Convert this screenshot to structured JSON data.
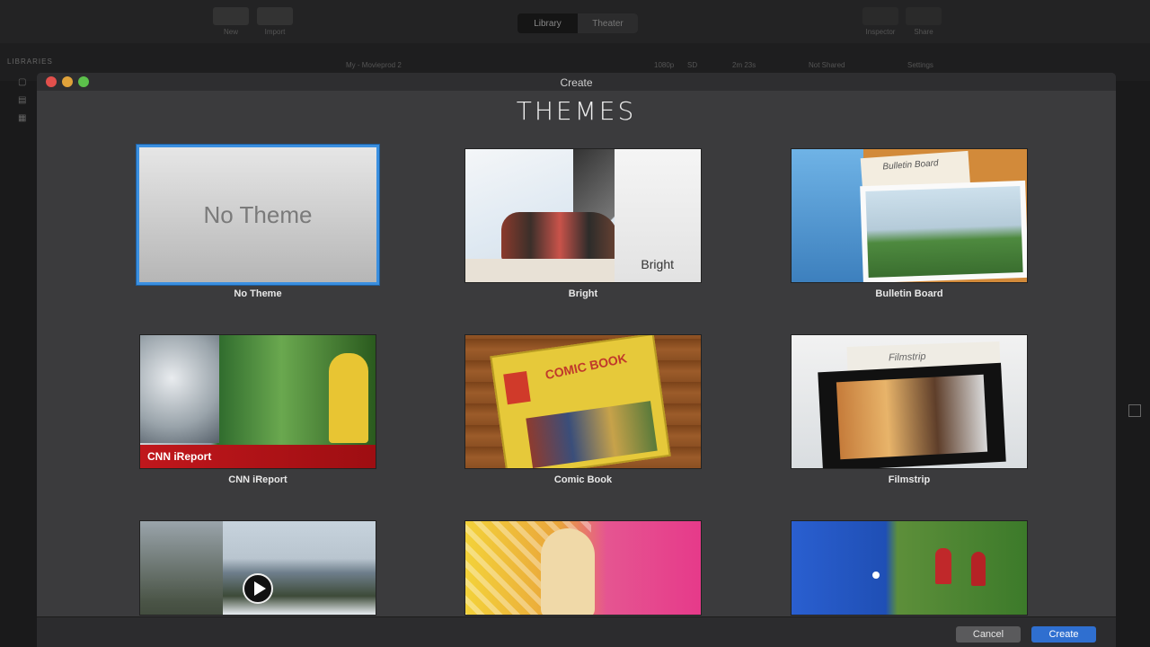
{
  "background_app": {
    "toolbar": {
      "new_label": "New",
      "import_label": "Import",
      "seg": [
        "Library",
        "Theater"
      ],
      "right_labels": [
        "Inspector",
        "Share"
      ]
    },
    "libraries_label": "LIBRARIES",
    "subbar": {
      "project": "My - Movieprod 2",
      "hd": "1080p",
      "sd": "SD",
      "duration": "2m 23s",
      "all_shared": "Not Shared",
      "settings": "Settings"
    }
  },
  "dialog": {
    "window_title": "Create",
    "heading": "THEMES",
    "themes": [
      {
        "name": "No Theme",
        "thumb_text": "No Theme",
        "selected": true
      },
      {
        "name": "Bright",
        "thumb_text": "Bright",
        "selected": false
      },
      {
        "name": "Bulletin Board",
        "thumb_text": "Bulletin Board",
        "selected": false
      },
      {
        "name": "CNN iReport",
        "thumb_text": "CNN iReport",
        "selected": false
      },
      {
        "name": "Comic Book",
        "thumb_text": "COMIC BOOK",
        "selected": false
      },
      {
        "name": "Filmstrip",
        "thumb_text": "Filmstrip",
        "selected": false
      },
      {
        "name": "",
        "thumb_text": "",
        "selected": false
      },
      {
        "name": "",
        "thumb_text": "",
        "selected": false
      },
      {
        "name": "",
        "thumb_text": "",
        "selected": false
      }
    ],
    "buttons": {
      "cancel": "Cancel",
      "create": "Create"
    },
    "colors": {
      "accent": "#2f6fd0",
      "selection": "#3a8fe0",
      "background": "#3b3b3d"
    }
  }
}
